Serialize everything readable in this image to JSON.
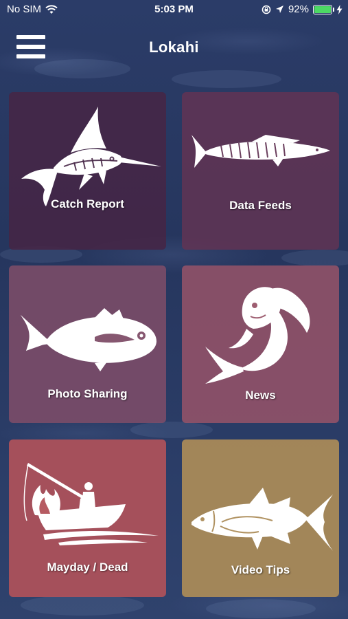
{
  "status_bar": {
    "carrier": "No SIM",
    "time": "5:03 PM",
    "battery_percent": "92%",
    "battery_level": 0.92,
    "icons": [
      "wifi-icon",
      "orientation-lock-icon",
      "location-arrow-icon",
      "battery-icon",
      "charging-bolt-icon"
    ]
  },
  "header": {
    "title": "Lokahi",
    "menu_icon": "hamburger-menu-icon"
  },
  "tiles": [
    {
      "label": "Catch Report",
      "icon": "marlin-icon"
    },
    {
      "label": "Data Feeds",
      "icon": "wahoo-icon"
    },
    {
      "label": "Photo Sharing",
      "icon": "trevally-icon"
    },
    {
      "label": "News",
      "icon": "mahi-mahi-icon"
    },
    {
      "label": "Mayday / Dead",
      "icon": "burning-boat-icon"
    },
    {
      "label": "Video Tips",
      "icon": "tuna-icon"
    }
  ],
  "colors": {
    "background": "#2a3a63",
    "tile_catch_report": "#46264a",
    "tile_data_feeds": "#623454",
    "tile_photo_sharing": "#804e68",
    "tile_news": "#985468",
    "tile_mayday": "#b2525a",
    "tile_video_tips": "#ac8c58",
    "battery_fill": "#4cd964"
  }
}
